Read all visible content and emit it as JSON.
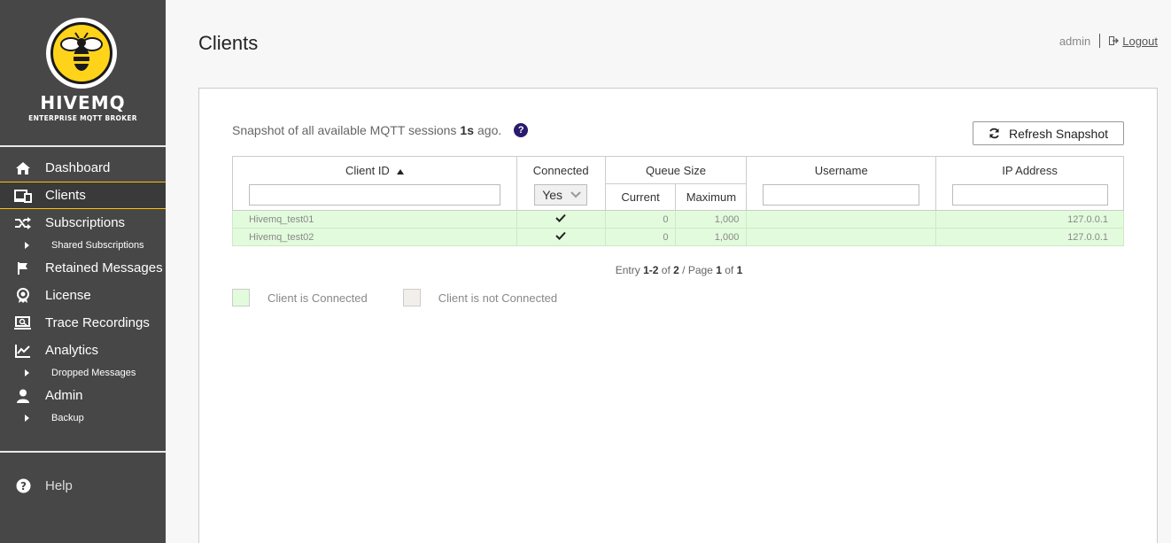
{
  "brand": {
    "name": "HIVEMQ",
    "tagline": "ENTERPRISE MQTT BROKER"
  },
  "sidebar": {
    "items": [
      {
        "label": "Dashboard",
        "icon": "home-icon"
      },
      {
        "label": "Clients",
        "icon": "clients-icon",
        "active": true
      },
      {
        "label": "Subscriptions",
        "icon": "shuffle-icon"
      },
      {
        "label": "Shared Subscriptions",
        "sub": true
      },
      {
        "label": "Retained Messages",
        "icon": "flag-icon"
      },
      {
        "label": "License",
        "icon": "award-icon"
      },
      {
        "label": "Trace Recordings",
        "icon": "trace-icon"
      },
      {
        "label": "Analytics",
        "icon": "chart-line-icon"
      },
      {
        "label": "Dropped Messages",
        "sub": true
      },
      {
        "label": "Admin",
        "icon": "user-icon"
      },
      {
        "label": "Backup",
        "sub": true
      }
    ],
    "help_label": "Help"
  },
  "header": {
    "title": "Clients",
    "username": "admin",
    "logout_label": "Logout"
  },
  "snapshot": {
    "prefix": "Snapshot of all available MQTT sessions",
    "age": "1s",
    "suffix": "ago.",
    "refresh_label": "Refresh Snapshot"
  },
  "table": {
    "headers": {
      "client_id": "Client ID",
      "connected": "Connected",
      "queue_size": "Queue Size",
      "current": "Current",
      "maximum": "Maximum",
      "username": "Username",
      "ip_address": "IP Address"
    },
    "connected_filter": "Yes",
    "rows": [
      {
        "client_id": "Hivemq_test01",
        "connected": true,
        "current": "0",
        "maximum": "1,000",
        "username": "",
        "ip": "127.0.0.1"
      },
      {
        "client_id": "Hivemq_test02",
        "connected": true,
        "current": "0",
        "maximum": "1,000",
        "username": "",
        "ip": "127.0.0.1"
      }
    ]
  },
  "pager": {
    "entry_word": "Entry",
    "range": "1-2",
    "of": "of",
    "total": "2",
    "page_word": "/ Page",
    "page": "1",
    "pages": "1"
  },
  "legend": {
    "connected_label": "Client is Connected",
    "not_connected_label": "Client is not Connected",
    "connected_color": "#e2fbdc",
    "not_connected_color": "#f2efea"
  },
  "colors": {
    "sidebar_bg": "#474747",
    "accent": "#ffc000",
    "help_icon": "#2a1a6e"
  }
}
